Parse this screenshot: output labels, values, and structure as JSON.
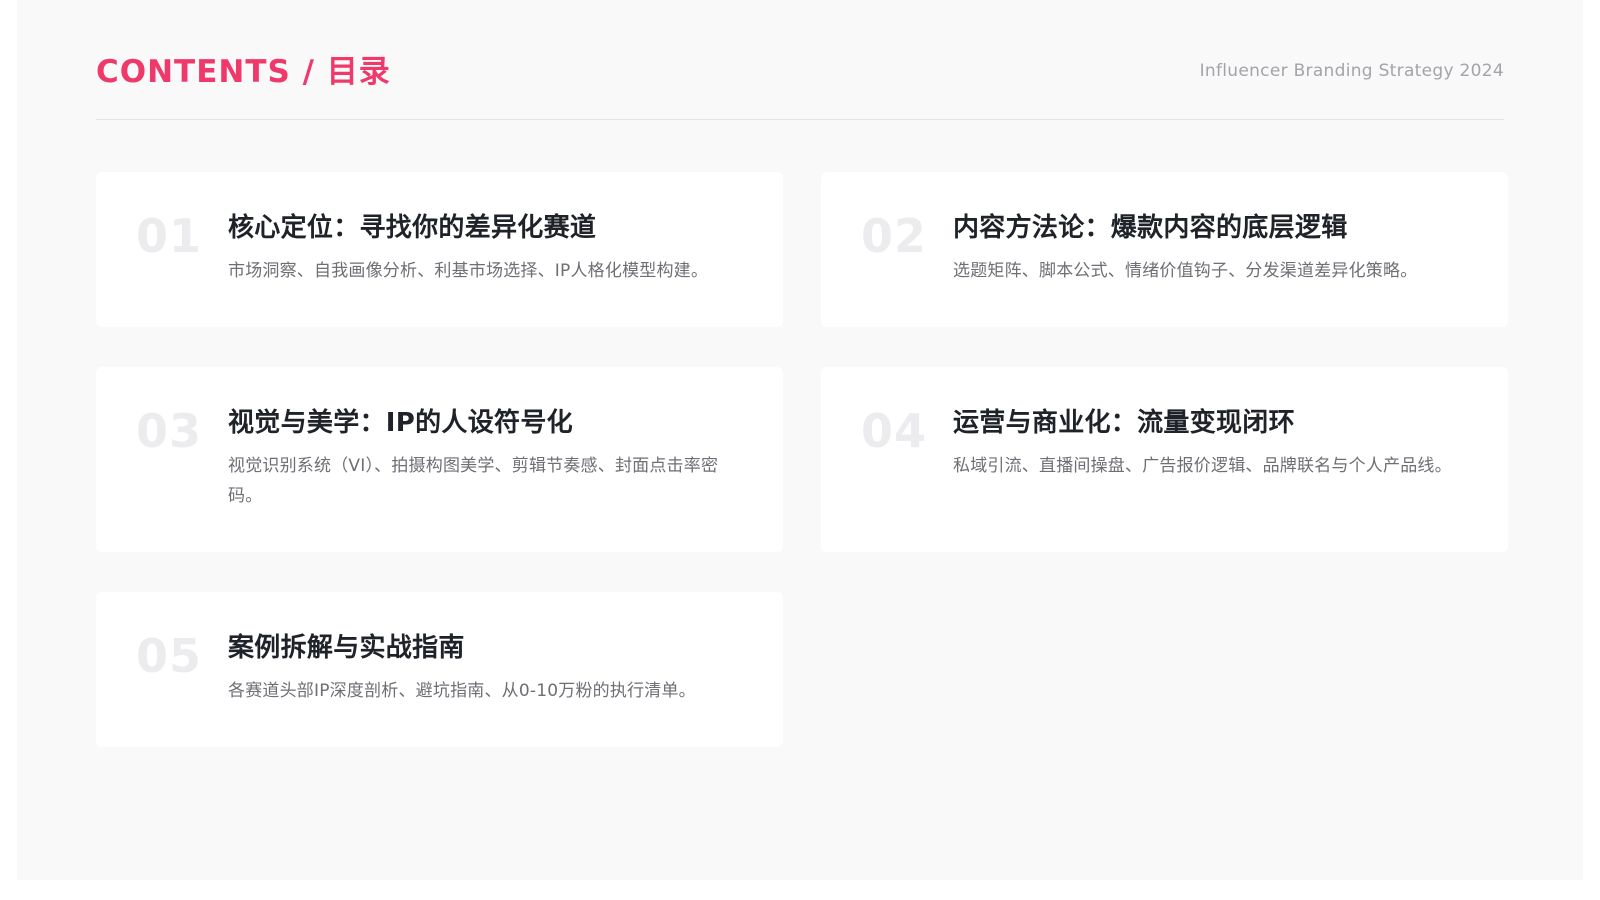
{
  "header": {
    "title": "CONTENTS / 目录",
    "subtitle": "Influencer Branding Strategy 2024"
  },
  "items": [
    {
      "number": "01",
      "title": "核心定位：寻找你的差异化赛道",
      "description": "市场洞察、自我画像分析、利基市场选择、IP人格化模型构建。"
    },
    {
      "number": "02",
      "title": "内容方法论：爆款内容的底层逻辑",
      "description": "选题矩阵、脚本公式、情绪价值钩子、分发渠道差异化策略。"
    },
    {
      "number": "03",
      "title": "视觉与美学：IP的人设符号化",
      "description": "视觉识别系统（VI）、拍摄构图美学、剪辑节奏感、封面点击率密码。"
    },
    {
      "number": "04",
      "title": "运营与商业化：流量变现闭环",
      "description": "私域引流、直播间操盘、广告报价逻辑、品牌联名与个人产品线。"
    },
    {
      "number": "05",
      "title": "案例拆解与实战指南",
      "description": "各赛道头部IP深度剖析、避坑指南、从0-10万粉的执行清单。"
    }
  ]
}
